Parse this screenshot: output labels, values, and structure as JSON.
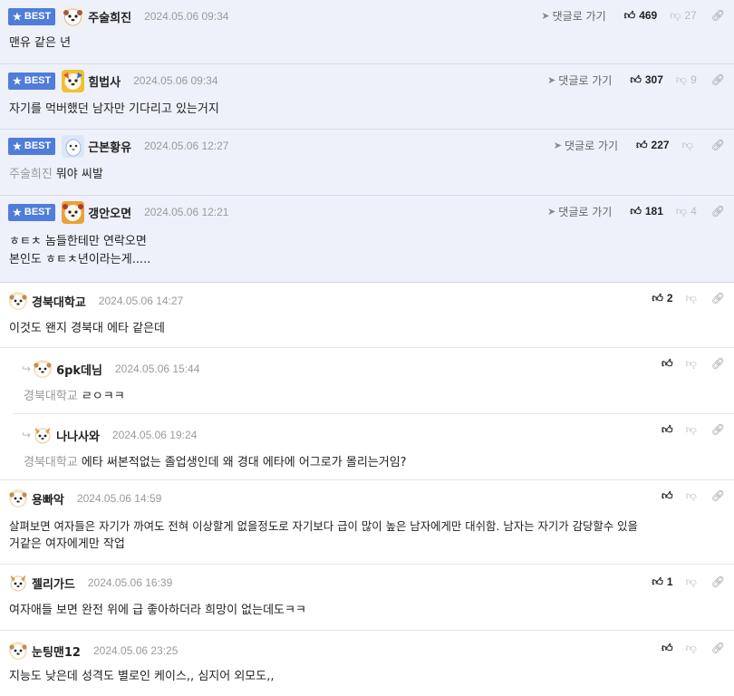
{
  "best_label": "BEST",
  "goto_label": "댓글로 가기",
  "best_comments": [
    {
      "nick": "주술희진",
      "date": "2024.05.06 09:34",
      "up": "469",
      "down": "27",
      "lines": [
        "맨유 같은 년"
      ],
      "ref": ""
    },
    {
      "nick": "힘법사",
      "date": "2024.05.06 09:34",
      "up": "307",
      "down": "9",
      "lines": [
        "자기를 먹버했던 남자만 기다리고 있는거지"
      ],
      "ref": ""
    },
    {
      "nick": "근본황유",
      "date": "2024.05.06 12:27",
      "up": "227",
      "down": "",
      "lines": [
        "뭐야 씨발"
      ],
      "ref": "주술희진"
    },
    {
      "nick": "갱안오면",
      "date": "2024.05.06 12:21",
      "up": "181",
      "down": "4",
      "lines": [
        "ㅎㅌㅊ 놈들한테만 연락오면",
        "본인도 ㅎㅌㅊ년이라는게....."
      ],
      "ref": ""
    }
  ],
  "comments": [
    {
      "nick": "경북대학교",
      "date": "2024.05.06 14:27",
      "up": "2",
      "lines": [
        "이것도 왠지 경북대 에타 같은데"
      ],
      "ref": "",
      "reply": false
    },
    {
      "nick": "6pk데님",
      "date": "2024.05.06 15:44",
      "up": "",
      "lines": [
        "ㄹㅇㅋㅋ"
      ],
      "ref": "경북대학교",
      "reply": true
    },
    {
      "nick": "나나사와",
      "date": "2024.05.06 19:24",
      "up": "",
      "lines": [
        "에타 써본적없는 졸업생인데 왜 경대 에타에 어그로가 몰리는거임?"
      ],
      "ref": "경북대학교",
      "reply": true
    },
    {
      "nick": "용빠악",
      "date": "2024.05.06 14:59",
      "up": "",
      "lines": [
        "살펴보면 여자들은 자기가 까여도 전혀 이상할게 없을정도로 자기보다 급이 많이 높은 남자에게만 대쉬함. 남자는 자기가 감당할수 있을",
        "거같은 여자에게만 작업"
      ],
      "ref": "",
      "reply": false
    },
    {
      "nick": "젤리가드",
      "date": "2024.05.06 16:39",
      "up": "1",
      "lines": [
        "여자애들 보면 완전 위에 급 좋아하더라 희망이 없는데도ㅋㅋ"
      ],
      "ref": "",
      "reply": false
    },
    {
      "nick": "눈팅맨12",
      "date": "2024.05.06 23:25",
      "up": "",
      "lines": [
        "지능도 낮은데 성격도 별로인 케이스,, 심지어 외모도,,"
      ],
      "ref": "",
      "reply": false
    }
  ],
  "colors": {
    "best_badge": "#4f7dd9",
    "best_bg": "#eef1f9",
    "muted": "#9a9a9a"
  }
}
